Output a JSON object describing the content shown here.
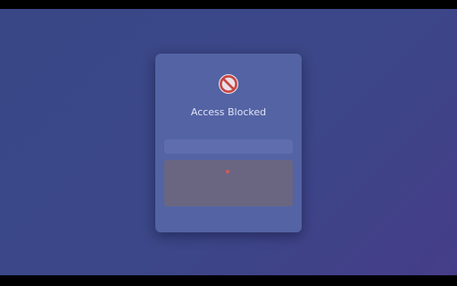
{
  "page": {
    "title": "Access Blocked",
    "icon": "blocked-icon",
    "colors": {
      "background_start": "#3d4b8e",
      "background_end": "#4a4190",
      "card": "#5463a4",
      "warning_box": "#6a6682",
      "warning_text": "#d6c06a",
      "block_icon_red": "#c9453f"
    }
  }
}
